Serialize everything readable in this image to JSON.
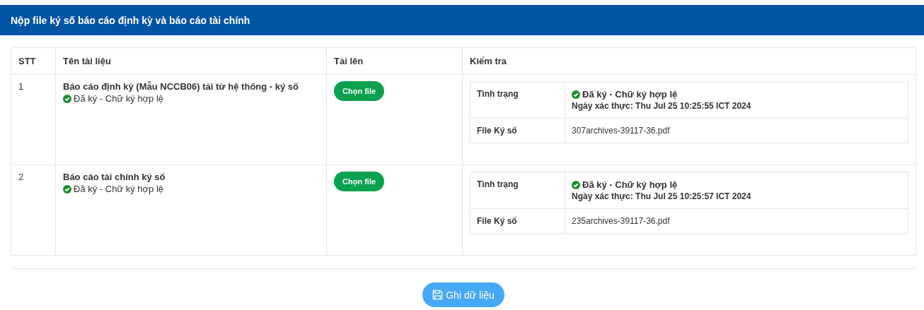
{
  "panel": {
    "title": "Nộp file ký số báo cáo định kỳ và báo cáo tài chính"
  },
  "table": {
    "columns": [
      "STT",
      "Tên tài liệu",
      "Tải lên",
      "Kiểm tra"
    ],
    "rows": [
      {
        "index": "1",
        "name": "Báo cáo định kỳ (Mẫu NCCB06) tải từ hệ thống - ký số",
        "signed": true,
        "sign_status": "Đã ký - Chữ ký hợp lệ",
        "upload_button": "Chọn file",
        "check": {
          "status_label": "Tình trạng",
          "status": "Đã ký - Chữ ký hợp lệ",
          "verified": "Ngày xác thực: Thu Jul 25 10:25:55 ICT 2024",
          "file_label": "File Ký số",
          "file": "307archives-39117-36.pdf"
        }
      },
      {
        "index": "2",
        "name": "Báo cáo tài chính ký số",
        "signed": true,
        "sign_status": "Đã ký - Chữ ký hợp lệ",
        "upload_button": "Chọn file",
        "check": {
          "status_label": "Tình trạng",
          "status": "Đã ký - Chữ ký hợp lệ",
          "verified": "Ngày xác thực: Thu Jul 25 10:25:57 ICT 2024",
          "file_label": "File Ký số",
          "file": "235archives-39117-36.pdf"
        }
      }
    ]
  },
  "save_button": "Ghi dữ liệu"
}
